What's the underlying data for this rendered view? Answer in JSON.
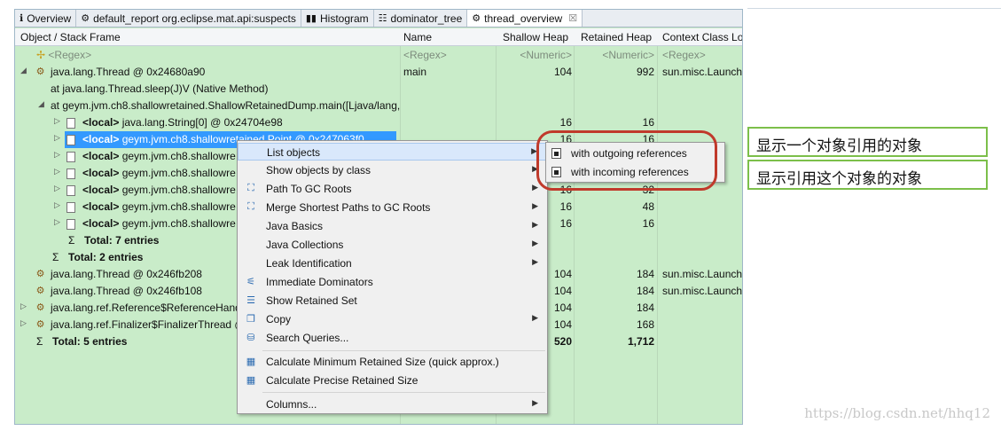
{
  "tabs": [
    {
      "icon": "info-icon",
      "glyph": "ℹ",
      "label": "Overview"
    },
    {
      "icon": "report-icon",
      "glyph": "⚙",
      "label": "default_report  org.eclipse.mat.api:suspects"
    },
    {
      "icon": "histogram-icon",
      "glyph": "▮▮",
      "label": "Histogram"
    },
    {
      "icon": "dominator-tree-icon",
      "glyph": "☷",
      "label": "dominator_tree"
    },
    {
      "icon": "thread-icon",
      "glyph": "⚙",
      "label": "thread_overview",
      "close": "☒"
    }
  ],
  "columns": {
    "object": "Object / Stack Frame",
    "name": "Name",
    "shallow": "Shallow Heap",
    "retained": "Retained Heap",
    "context": "Context Class Lo"
  },
  "filter": {
    "object": "<Regex>",
    "name": "<Regex>",
    "shallow": "<Numeric>",
    "retained": "<Numeric>",
    "context": "<Regex>"
  },
  "rows": {
    "thread1": {
      "label": "java.lang.Thread @ 0x24680a90",
      "name": "main",
      "shallow": "104",
      "retained": "992",
      "context": "sun.misc.Launche"
    },
    "frame1": {
      "label": "at java.lang.Thread.sleep(J)V (Native Method)"
    },
    "frame2": {
      "label": "at geym.jvm.ch8.shallowretained.ShallowRetainedDump.main([Ljava/lang,"
    },
    "local1": {
      "prefix": "<local>",
      "label": " java.lang.String[0] @ 0x24704e98",
      "shallow": "16",
      "retained": "16"
    },
    "local2": {
      "prefix": "<local>",
      "label": " geym.jvm.ch8.shallowretained.Point @ 0x247063f0",
      "shallow": "16",
      "retained": "16"
    },
    "local3": {
      "prefix": "<local>",
      "label": " geym.jvm.ch8.shallowre"
    },
    "local4": {
      "prefix": "<local>",
      "label": " geym.jvm.ch8.shallowre"
    },
    "local5": {
      "prefix": "<local>",
      "label": " geym.jvm.ch8.shallowre",
      "shallow": "16",
      "retained": "32"
    },
    "local6": {
      "prefix": "<local>",
      "label": " geym.jvm.ch8.shallowre",
      "shallow": "16",
      "retained": "48"
    },
    "local7": {
      "prefix": "<local>",
      "label": " geym.jvm.ch8.shallowre",
      "shallow": "16",
      "retained": "16"
    },
    "total7": {
      "label": "Total: 7 entries"
    },
    "total2": {
      "label": "Total: 2 entries"
    },
    "thread2": {
      "label": "java.lang.Thread @ 0x246fb208",
      "shallow": "104",
      "retained": "184",
      "context": "sun.misc.Launche"
    },
    "thread3": {
      "label": "java.lang.Thread @ 0x246fb108",
      "shallow": "104",
      "retained": "184",
      "context": "sun.misc.Launche"
    },
    "thread4": {
      "label": "java.lang.ref.Reference$ReferenceHand",
      "shallow": "104",
      "retained": "184"
    },
    "thread5": {
      "label": "java.lang.ref.Finalizer$FinalizerThread @",
      "shallow": "104",
      "retained": "168"
    },
    "total5": {
      "label": "Total: 5 entries",
      "shallow": "520",
      "retained": "1,712"
    }
  },
  "menu": {
    "list_objects": "List objects",
    "show_by_class": "Show objects by class",
    "path_gc_roots": "Path To GC Roots",
    "merge_paths": "Merge Shortest Paths to GC Roots",
    "java_basics": "Java Basics",
    "java_collections": "Java Collections",
    "leak_identification": "Leak Identification",
    "immediate_dominators": "Immediate Dominators",
    "show_retained_set": "Show Retained Set",
    "copy": "Copy",
    "search_queries": "Search Queries...",
    "calc_min": "Calculate Minimum Retained Size (quick approx.)",
    "calc_precise": "Calculate Precise Retained Size",
    "columns": "Columns..."
  },
  "submenu": {
    "outgoing": "with outgoing references",
    "incoming": "with incoming references"
  },
  "annotations": {
    "outgoing_note": "显示一个对象引用的对象",
    "incoming_note": "显示引用这个对象的对象"
  },
  "watermark": "https://blog.csdn.net/hhq12",
  "colors": {
    "background": "#c9ecc9",
    "selection": "#3399ff",
    "highlight_oval": "#c03a2b",
    "annotation_border": "#7cbf4a"
  }
}
